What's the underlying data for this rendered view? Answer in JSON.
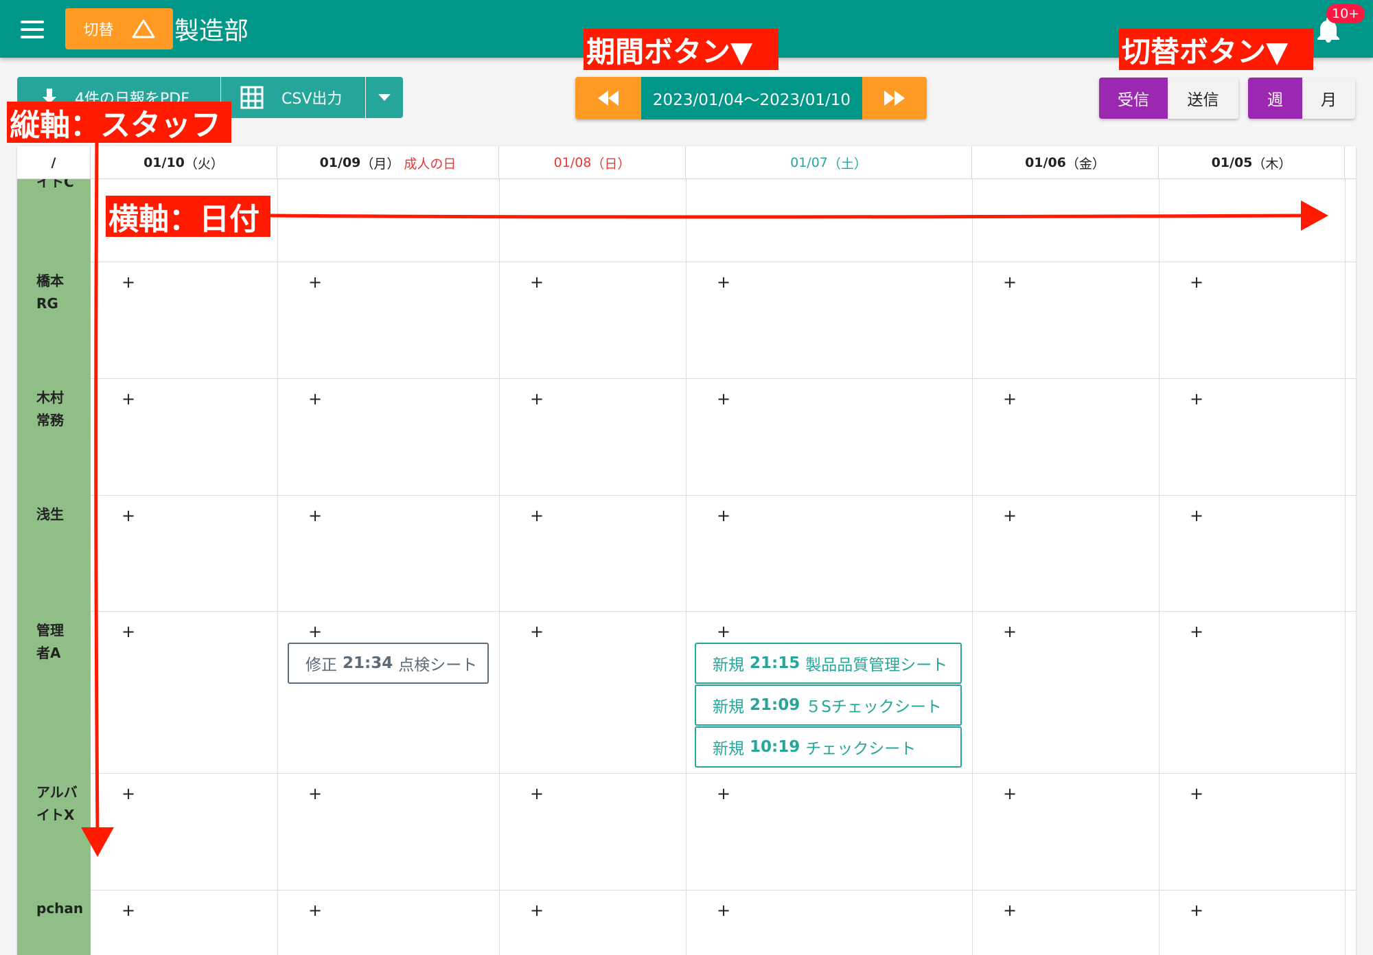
{
  "app_bar": {
    "switch_label": "切替",
    "department": "製造部",
    "notification_badge": "10+"
  },
  "toolbar": {
    "pdf_label": "4件の日報をPDF",
    "csv_label": "CSV出力",
    "period_label": "2023/01/04〜2023/01/10",
    "direction_options": [
      "受信",
      "送信"
    ],
    "direction_selected": "受信",
    "view_options": [
      "週",
      "月"
    ],
    "view_selected": "週"
  },
  "calendar": {
    "corner_label": "/",
    "columns": [
      {
        "date": "01/10",
        "dow": "（火）",
        "holiday": "",
        "color": "#222222"
      },
      {
        "date": "01/09",
        "dow": "（月）",
        "holiday": "成人の日",
        "color": "#222222"
      },
      {
        "date": "01/08",
        "dow": "（日）",
        "holiday": "",
        "color": "#e53935"
      },
      {
        "date": "01/07",
        "dow": "（土）",
        "holiday": "",
        "color": "#26a69a"
      },
      {
        "date": "01/06",
        "dow": "（金）",
        "holiday": "",
        "color": "#222222"
      },
      {
        "date": "01/05",
        "dow": "（木）",
        "holiday": "",
        "color": "#222222"
      }
    ],
    "staff": [
      {
        "line1": "イトC",
        "line2": ""
      },
      {
        "line1": "橋本",
        "line2": "RG"
      },
      {
        "line1": "木村",
        "line2": "常務"
      },
      {
        "line1": "浅生",
        "line2": ""
      },
      {
        "line1": "管理",
        "line2": "者A"
      },
      {
        "line1": "アルバ",
        "line2": "イトX"
      },
      {
        "line1": "pchan",
        "line2": ""
      }
    ],
    "add_symbol": "+",
    "entries": [
      {
        "status": "修正",
        "time": "21:34",
        "title": "点検シート"
      },
      {
        "status": "新規",
        "time": "21:15",
        "title": "製品品質管理シート"
      },
      {
        "status": "新規",
        "time": "21:09",
        "title": "５Sチェックシート"
      },
      {
        "status": "新規",
        "time": "10:19",
        "title": "チェックシート"
      }
    ]
  },
  "annotations": {
    "period": "期間ボタン▼",
    "switch": "切替ボタン▼",
    "vertical": "縦軸：スタッフ",
    "horizontal": "横軸：日付"
  },
  "colors": {
    "primary": "#009688",
    "accent_orange": "#ff9a25",
    "purple": "#9c27b0",
    "staff_bg": "#8fbf87",
    "annotation_red": "#ff1a00"
  },
  "icons": [
    "menu-icon",
    "triangle-icon",
    "bell-icon",
    "download-icon",
    "grid-icon",
    "chevron-down-icon",
    "rewind-icon",
    "fast-forward-icon"
  ]
}
